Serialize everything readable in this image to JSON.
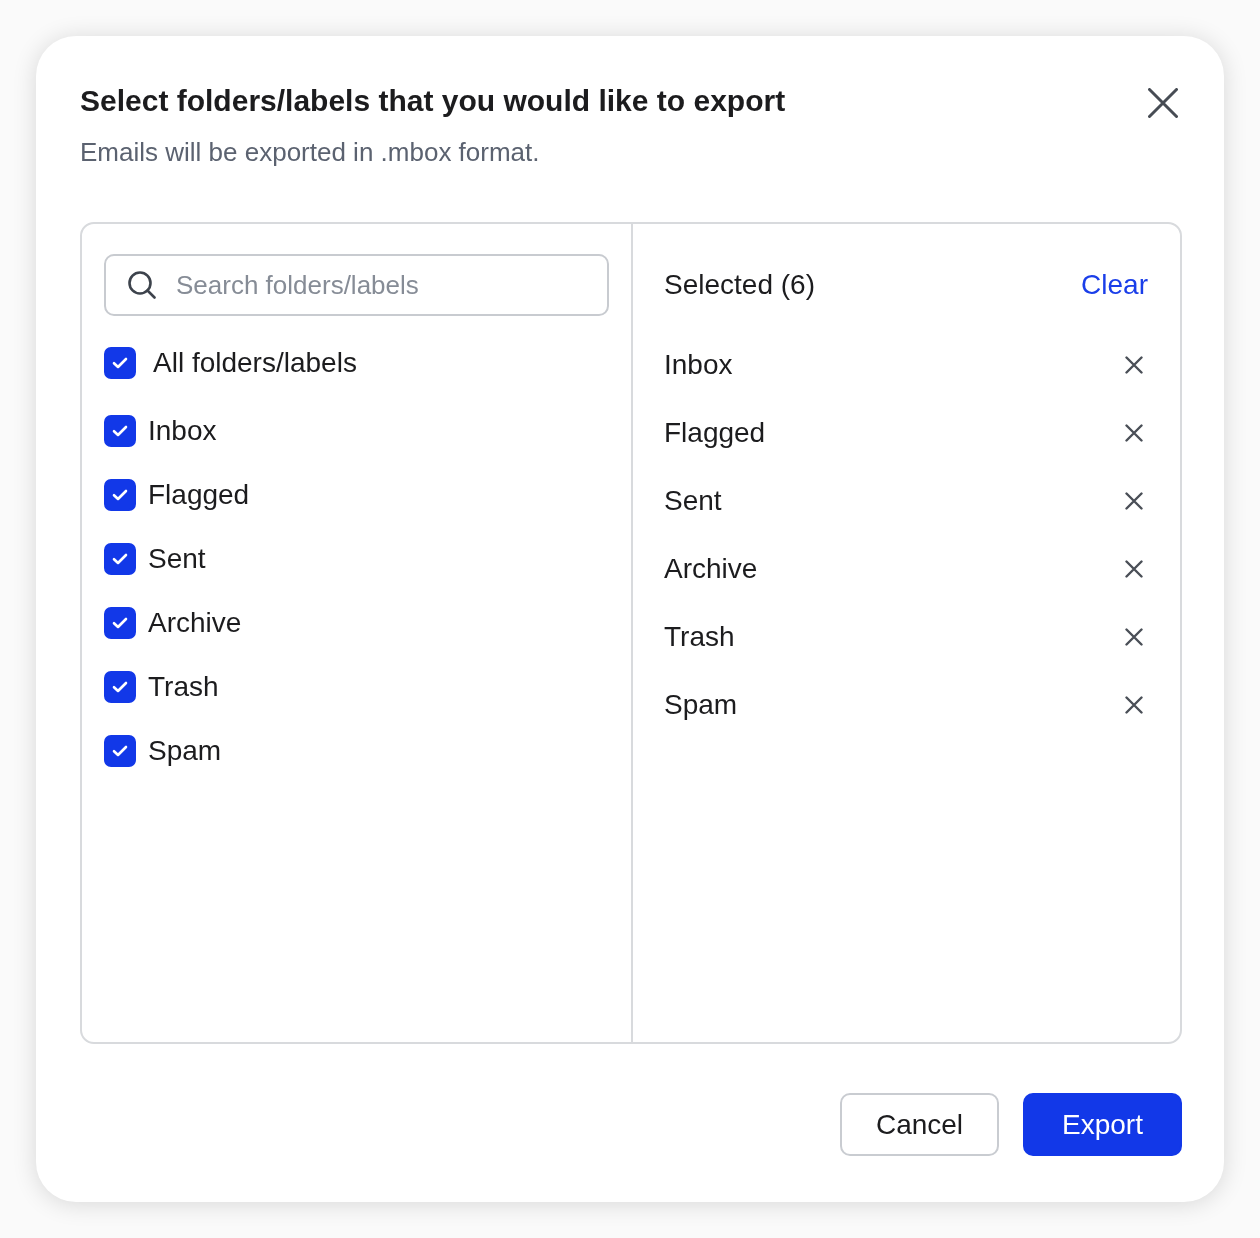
{
  "dialog": {
    "title": "Select folders/labels that you would like to export",
    "subtitle": "Emails will be exported in .mbox format."
  },
  "search": {
    "placeholder": "Search folders/labels"
  },
  "all_folders": {
    "label": "All folders/labels",
    "checked": true
  },
  "folders": [
    {
      "label": "Inbox",
      "checked": true
    },
    {
      "label": "Flagged",
      "checked": true
    },
    {
      "label": "Sent",
      "checked": true
    },
    {
      "label": "Archive",
      "checked": true
    },
    {
      "label": "Trash",
      "checked": true
    },
    {
      "label": "Spam",
      "checked": true
    }
  ],
  "selected_panel": {
    "heading": "Selected (6)",
    "clear": "Clear",
    "items": [
      "Inbox",
      "Flagged",
      "Sent",
      "Archive",
      "Trash",
      "Spam"
    ]
  },
  "buttons": [
    {
      "label": "Cancel",
      "kind": "secondary"
    },
    {
      "label": "Export",
      "kind": "primary"
    }
  ]
}
